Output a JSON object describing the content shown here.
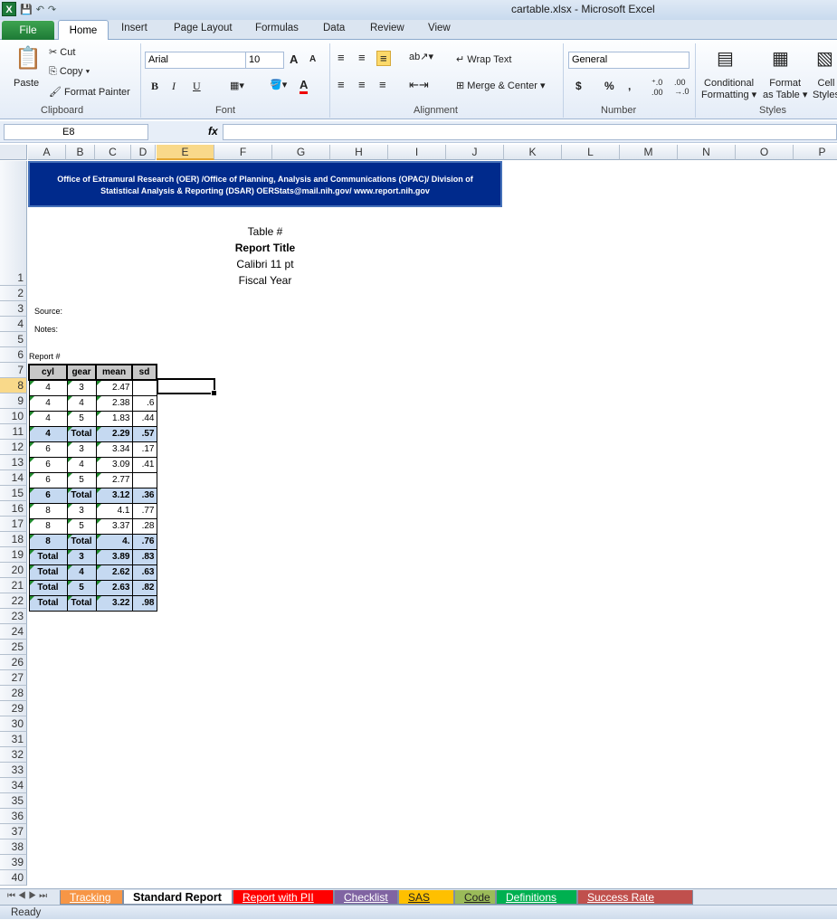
{
  "window": {
    "title": "cartable.xlsx  -  Microsoft Excel"
  },
  "ribbon_tabs": [
    "File",
    "Home",
    "Insert",
    "Page Layout",
    "Formulas",
    "Data",
    "Review",
    "View"
  ],
  "clipboard": {
    "paste": "Paste",
    "cut": "Cut",
    "copy": "Copy",
    "format_painter": "Format Painter",
    "label": "Clipboard"
  },
  "font": {
    "name": "Arial",
    "size": "10",
    "bold": "B",
    "italic": "I",
    "underline": "U",
    "label": "Font",
    "grow": "A",
    "shrink": "A"
  },
  "alignment": {
    "wrap": "Wrap Text",
    "merge": "Merge & Center",
    "label": "Alignment"
  },
  "number": {
    "format": "General",
    "currency": "$",
    "percent": "%",
    "comma": ",",
    "inc_dec": "←.0 .00",
    "dec_dec": ".00 →.0",
    "label": "Number"
  },
  "styles": {
    "conditional": "Conditional",
    "conditional2": "Formatting",
    "format_table": "Format",
    "format_table2": "as Table",
    "cell_styles": "Cell",
    "cell_styles2": "Styles",
    "label": "Styles"
  },
  "formula_bar": {
    "name_box": "E8",
    "fx": "fx",
    "formula": ""
  },
  "columns": [
    "A",
    "B",
    "C",
    "D",
    "E",
    "F",
    "G",
    "H",
    "I",
    "J",
    "K",
    "L",
    "M",
    "N",
    "O",
    "P"
  ],
  "rows": [
    "1",
    "2",
    "3",
    "4",
    "5",
    "6",
    "7",
    "8",
    "9",
    "10",
    "11",
    "12",
    "13",
    "14",
    "15",
    "16",
    "17",
    "18",
    "19",
    "20",
    "21",
    "22",
    "23",
    "24",
    "25",
    "26",
    "27",
    "28",
    "29",
    "30",
    "31",
    "32",
    "33",
    "34",
    "35",
    "36",
    "37",
    "38",
    "39",
    "40"
  ],
  "banner": {
    "line1": "Office of Extramural Research (OER) /Office of Planning, Analysis and Communications (OPAC)/ Division of",
    "line2": "Statistical Analysis & Reporting (DSAR) OERStats@mail.nih.gov/ www.report.nih.gov"
  },
  "header_block": {
    "table_no": "Table #",
    "title": "Report Title",
    "font": "Calibri 11 pt",
    "year": "Fiscal Year"
  },
  "labels": {
    "source": "Source:",
    "notes": "Notes:",
    "report": "Report #"
  },
  "table": {
    "headers": [
      "cyl",
      "gear",
      "mean",
      "sd"
    ],
    "rows": [
      {
        "cyl": "4",
        "gear": "3",
        "mean": "2.47",
        "sd": "",
        "total": false
      },
      {
        "cyl": "4",
        "gear": "4",
        "mean": "2.38",
        "sd": ".6",
        "total": false
      },
      {
        "cyl": "4",
        "gear": "5",
        "mean": "1.83",
        "sd": ".44",
        "total": false
      },
      {
        "cyl": "4",
        "gear": "Total",
        "mean": "2.29",
        "sd": ".57",
        "total": true
      },
      {
        "cyl": "6",
        "gear": "3",
        "mean": "3.34",
        "sd": ".17",
        "total": false
      },
      {
        "cyl": "6",
        "gear": "4",
        "mean": "3.09",
        "sd": ".41",
        "total": false
      },
      {
        "cyl": "6",
        "gear": "5",
        "mean": "2.77",
        "sd": "",
        "total": false
      },
      {
        "cyl": "6",
        "gear": "Total",
        "mean": "3.12",
        "sd": ".36",
        "total": true
      },
      {
        "cyl": "8",
        "gear": "3",
        "mean": "4.1",
        "sd": ".77",
        "total": false
      },
      {
        "cyl": "8",
        "gear": "5",
        "mean": "3.37",
        "sd": ".28",
        "total": false
      },
      {
        "cyl": "8",
        "gear": "Total",
        "mean": "4.",
        "sd": ".76",
        "total": true
      },
      {
        "cyl": "Total",
        "gear": "3",
        "mean": "3.89",
        "sd": ".83",
        "total": true
      },
      {
        "cyl": "Total",
        "gear": "4",
        "mean": "2.62",
        "sd": ".63",
        "total": true
      },
      {
        "cyl": "Total",
        "gear": "5",
        "mean": "2.63",
        "sd": ".82",
        "total": true
      },
      {
        "cyl": "Total",
        "gear": "Total",
        "mean": "3.22",
        "sd": ".98",
        "total": true
      }
    ]
  },
  "sheet_tabs": [
    {
      "label": "Tracking",
      "color": "#f79646",
      "active": false
    },
    {
      "label": "Standard Report",
      "color": "#ffffff",
      "active": true
    },
    {
      "label": "Report with PII",
      "color": "#ff0000",
      "active": false
    },
    {
      "label": "Checklist",
      "color": "#8064a2",
      "active": false
    },
    {
      "label": "SAS Log",
      "color": "#ffc000",
      "active": false
    },
    {
      "label": "Code",
      "color": "#9bbb59",
      "active": false
    },
    {
      "label": "Definitions",
      "color": "#00b050",
      "active": false
    },
    {
      "label": "Success Rate Definit",
      "color": "#c0504d",
      "active": false
    }
  ],
  "status": {
    "text": "Ready"
  }
}
